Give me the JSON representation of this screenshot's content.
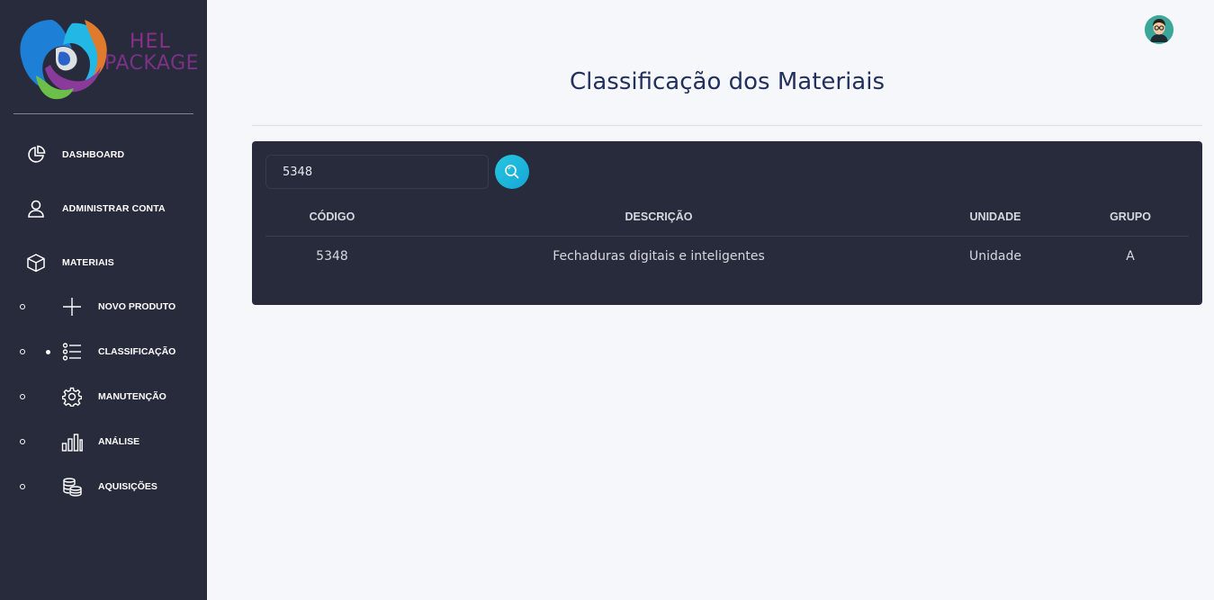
{
  "brand": {
    "line1": "HEL",
    "line2": "PACKAGE"
  },
  "sidebar": {
    "nav": [
      {
        "label": "DASHBOARD",
        "icon": "pie-chart-icon"
      },
      {
        "label": "ADMINISTRAR CONTA",
        "icon": "user-icon"
      },
      {
        "label": "MATERIAIS",
        "icon": "box-icon"
      }
    ],
    "sub": [
      {
        "label": "NOVO PRODUTO",
        "icon": "plus-icon",
        "active": false
      },
      {
        "label": "CLASSIFICAÇÃO",
        "icon": "list-icon",
        "active": true
      },
      {
        "label": "MANUTENÇÃO",
        "icon": "gear-icon",
        "active": false
      },
      {
        "label": "ANÁLISE",
        "icon": "bar-chart-icon",
        "active": false
      },
      {
        "label": "AQUISIÇÕES",
        "icon": "coins-icon",
        "active": false
      }
    ]
  },
  "page": {
    "title": "Classificação dos Materiais"
  },
  "search": {
    "value": "5348"
  },
  "table": {
    "headers": [
      "CÓDIGO",
      "DESCRIÇÃO",
      "UNIDADE",
      "GRUPO"
    ],
    "rows": [
      [
        "5348",
        "Fechaduras digitais e inteligentes",
        "Unidade",
        "A"
      ]
    ]
  },
  "colors": {
    "sidebar": "#272b3c",
    "accent": "#1fb8dc",
    "title": "#22305e",
    "background": "#f6f7fb"
  }
}
